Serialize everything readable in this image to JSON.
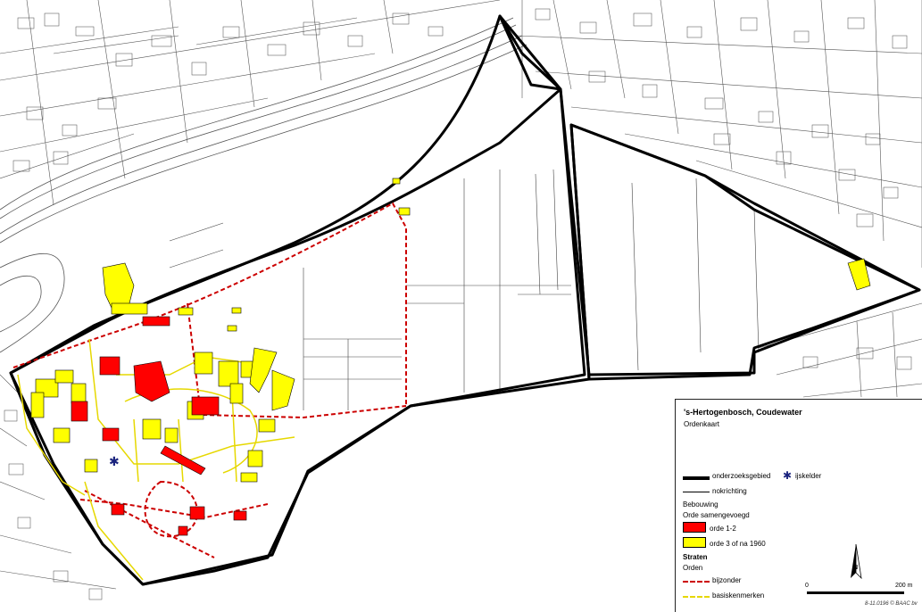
{
  "map": {
    "colors": {
      "study_boundary": "#000000",
      "order_1_2": "#ff0000",
      "order_3": "#ffff00",
      "street_special": "#cc0000",
      "street_basic": "#ffff00",
      "ice_cellar": "#1a237e"
    }
  },
  "legend": {
    "title": "'s-Hertogenbosch, Coudewater",
    "subtitle": "Ordenkaart",
    "items": {
      "boundary": "onderzoeksgebied",
      "ice_cellar": "ijskelder",
      "ridge": "nokrichting"
    },
    "buildings_header": "Bebouwing",
    "buildings_sub": "Orde samengevoegd",
    "order_1_2": "orde 1-2",
    "order_3": "orde 3 of na 1960",
    "streets_header": "Straten",
    "streets_sub": "Orden",
    "street_special": "bijzonder",
    "street_basic": "basiskenmerken",
    "scale_start": "0",
    "scale_end": "200 m",
    "north": "N",
    "credit": "8-11.0196 © BAAC bv"
  }
}
